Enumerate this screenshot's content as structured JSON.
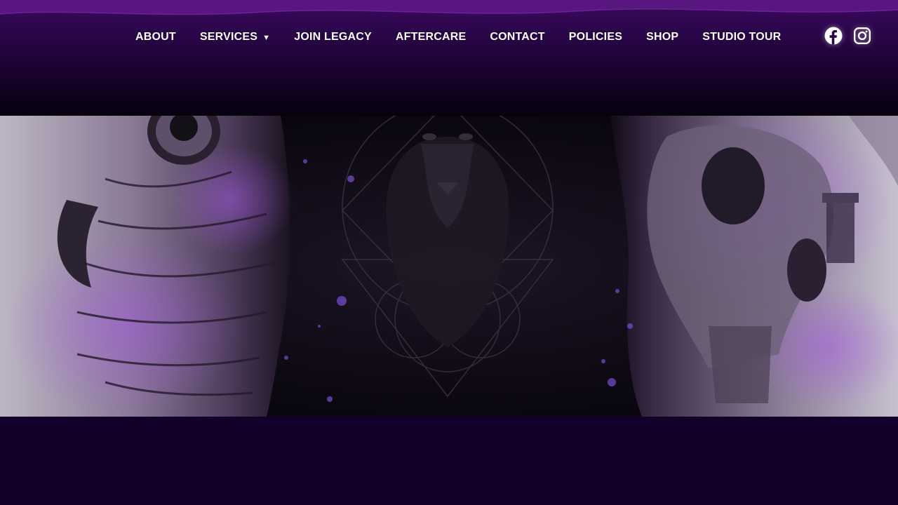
{
  "nav": {
    "items": [
      {
        "label": "ABOUT"
      },
      {
        "label": "SERVICES",
        "has_dropdown": true,
        "caret": "▼"
      },
      {
        "label": "JOIN LEGACY"
      },
      {
        "label": "AFTERCARE"
      },
      {
        "label": "CONTACT"
      },
      {
        "label": "POLICIES"
      },
      {
        "label": "SHOP"
      },
      {
        "label": "STUDIO TOUR"
      }
    ]
  },
  "social": [
    {
      "icon": "facebook-icon"
    },
    {
      "icon": "instagram-icon"
    }
  ],
  "hero": {
    "panels": [
      "owl-tattoo-image",
      "lion-geometric-emblem",
      "skull-tattoo-image"
    ]
  },
  "colors": {
    "header_top": "#3a0a5e",
    "header_bottom": "#06010d",
    "page_background": "#12002a",
    "accent_purple": "#a45be0",
    "nav_text": "#ffffff"
  }
}
